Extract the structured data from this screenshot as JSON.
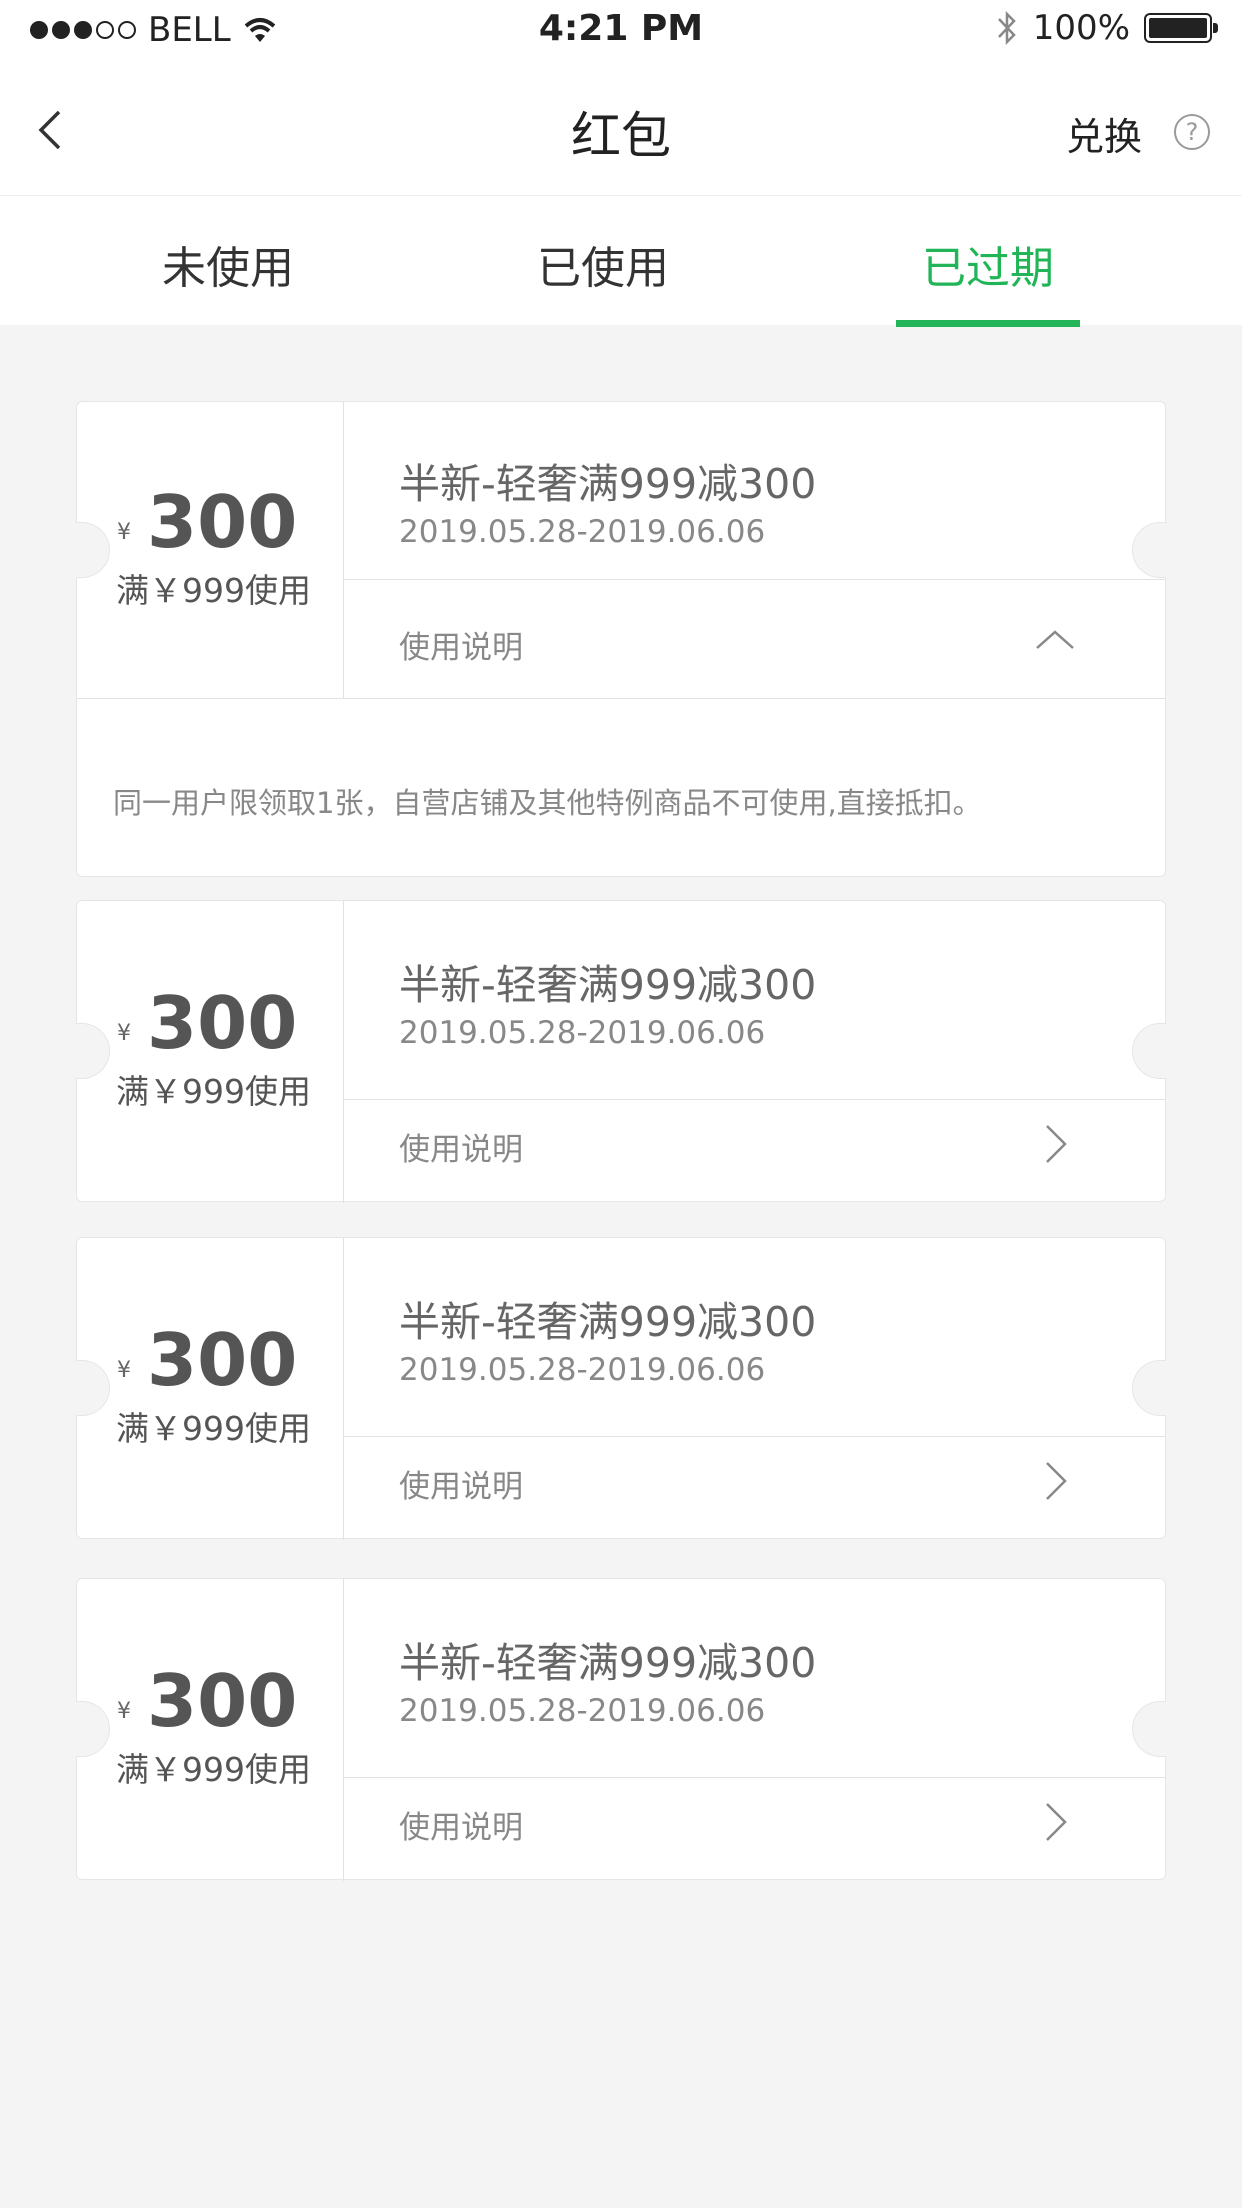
{
  "status_bar": {
    "carrier": "BELL",
    "time": "4:21 PM",
    "battery": "100%"
  },
  "nav": {
    "title": "红包",
    "exchange": "兑换",
    "help": "?"
  },
  "tabs": [
    {
      "label": "未使用"
    },
    {
      "label": "已使用"
    },
    {
      "label": "已过期"
    }
  ],
  "coupons": [
    {
      "currency": "¥",
      "amount": "300",
      "threshold": "满￥999使用",
      "title": "半新-轻奢满999减300",
      "date": "2019.05.28-2019.06.06",
      "usage_label": "使用说明",
      "expanded": true,
      "description": "同一用户限领取1张，自营店铺及其他特例商品不可使用,直接抵扣。"
    },
    {
      "currency": "¥",
      "amount": "300",
      "threshold": "满￥999使用",
      "title": "半新-轻奢满999减300",
      "date": "2019.05.28-2019.06.06",
      "usage_label": "使用说明",
      "expanded": false
    },
    {
      "currency": "¥",
      "amount": "300",
      "threshold": "满￥999使用",
      "title": "半新-轻奢满999减300",
      "date": "2019.05.28-2019.06.06",
      "usage_label": "使用说明",
      "expanded": false
    },
    {
      "currency": "¥",
      "amount": "300",
      "threshold": "满￥999使用",
      "title": "半新-轻奢满999减300",
      "date": "2019.05.28-2019.06.06",
      "usage_label": "使用说明",
      "expanded": false
    }
  ],
  "colors": {
    "accent": "#22b558",
    "background": "#f4f4f4"
  }
}
